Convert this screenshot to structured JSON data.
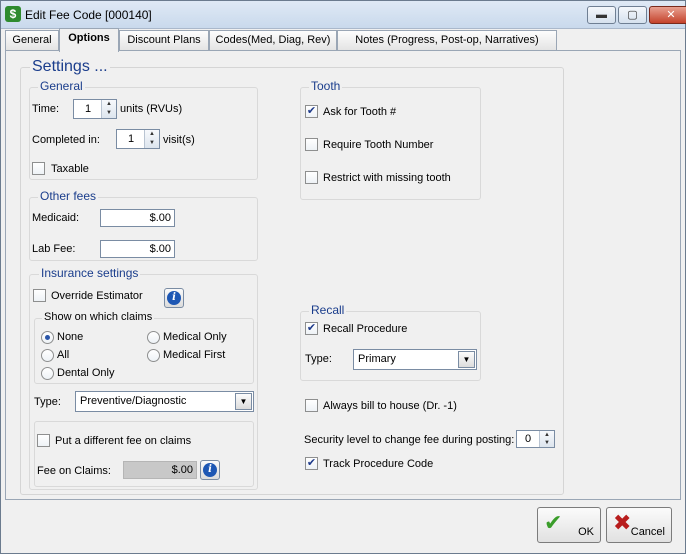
{
  "window": {
    "title": "Edit Fee Code [000140]",
    "app_icon_glyph": "$",
    "minimize_glyph": "▬",
    "maximize_glyph": "▢",
    "close_glyph": "✕"
  },
  "tabs": [
    {
      "label": "General"
    },
    {
      "label": "Options"
    },
    {
      "label": "Discount Plans"
    },
    {
      "label": "Codes(Med, Diag, Rev)"
    },
    {
      "label": "Notes (Progress, Post-op, Narratives)"
    }
  ],
  "settings": {
    "title": "Settings ...",
    "general": {
      "title": "General",
      "time_label": "Time:",
      "time_value": "1",
      "time_units": "units  (RVUs)",
      "completed_label": "Completed in:",
      "completed_value": "1",
      "completed_units": "visit(s)",
      "taxable_label": "Taxable",
      "taxable_checked": false
    },
    "other_fees": {
      "title": "Other fees",
      "medicaid_label": "Medicaid:",
      "medicaid_value": "$.00",
      "labfee_label": "Lab Fee:",
      "labfee_value": "$.00"
    },
    "insurance": {
      "title": "Insurance settings",
      "override_label": "Override Estimator",
      "override_checked": false,
      "show_claims_title": "Show on which claims",
      "radios": [
        {
          "label": "None",
          "selected": true
        },
        {
          "label": "Medical Only",
          "selected": false
        },
        {
          "label": "All",
          "selected": false
        },
        {
          "label": "Medical First",
          "selected": false
        },
        {
          "label": "Dental Only",
          "selected": false
        }
      ],
      "type_label": "Type:",
      "type_value": "Preventive/Diagnostic",
      "different_fee_label": "Put a different fee on claims",
      "different_fee_checked": false,
      "fee_on_claims_label": "Fee on Claims:",
      "fee_on_claims_value": "$.00"
    },
    "tooth": {
      "title": "Tooth",
      "ask_label": "Ask for Tooth #",
      "ask_checked": true,
      "require_label": "Require Tooth Number",
      "require_checked": false,
      "restrict_label": "Restrict with missing tooth",
      "restrict_checked": false
    },
    "recall": {
      "title": "Recall",
      "procedure_label": "Recall Procedure",
      "procedure_checked": true,
      "type_label": "Type:",
      "type_value": "Primary"
    },
    "always_bill_label": "Always bill to house (Dr. -1)",
    "always_bill_checked": false,
    "security_label": "Security level to change fee during posting:",
    "security_value": "0",
    "track_label": "Track Procedure Code",
    "track_checked": true
  },
  "buttons": {
    "ok_label": "OK",
    "ok_glyph": "✔",
    "ok_color": "#3a9d2a",
    "cancel_label": "Cancel",
    "cancel_glyph": "✖",
    "cancel_color": "#b81d1d"
  },
  "misc": {
    "check_glyph": "✔",
    "dropdown_glyph": "▼",
    "spin_up_glyph": "▲",
    "spin_down_glyph": "▼",
    "info_glyph": "i"
  }
}
